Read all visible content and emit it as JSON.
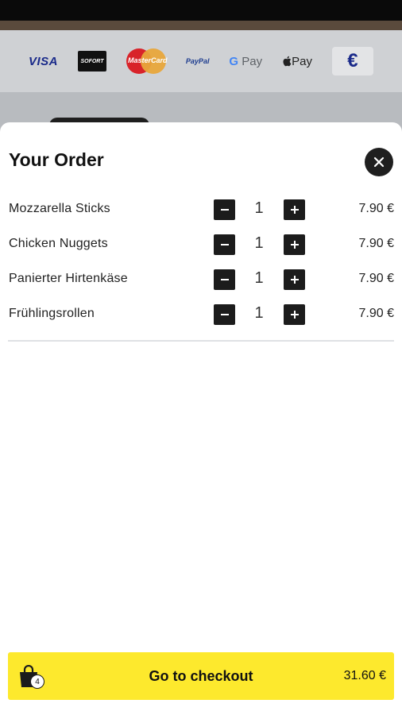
{
  "payment_methods": {
    "visa": "VISA",
    "sofort": "SOFORT",
    "mastercard": "MasterCard",
    "paypal": "PayPal",
    "gpay_g": "G",
    "gpay_text": "Pay",
    "applepay": "Pay",
    "euro": "€"
  },
  "order": {
    "title": "Your Order",
    "items": [
      {
        "name": "Mozzarella Sticks",
        "quantity": "1",
        "price": "7.90 €"
      },
      {
        "name": "Chicken Nuggets",
        "quantity": "1",
        "price": "7.90 €"
      },
      {
        "name": "Panierter Hirtenkäse",
        "quantity": "1",
        "price": "7.90 €"
      },
      {
        "name": "Frühlingsrollen",
        "quantity": "1",
        "price": "7.90 €"
      }
    ]
  },
  "checkout": {
    "label": "Go to checkout",
    "total": "31.60 €",
    "item_count": "4"
  },
  "colors": {
    "accent": "#fde92d",
    "dark": "#1c1c1c"
  }
}
